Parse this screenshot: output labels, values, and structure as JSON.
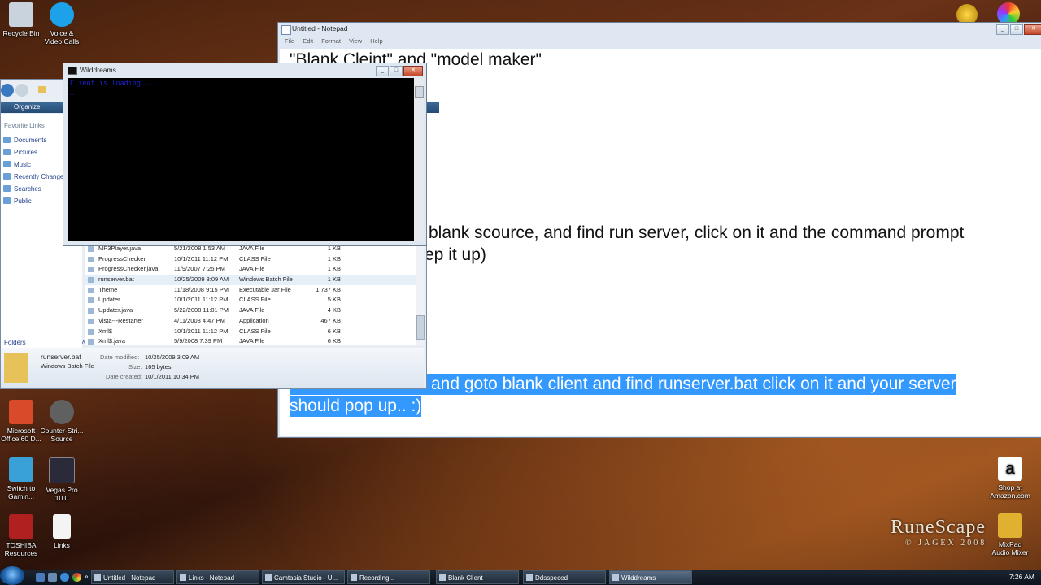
{
  "desktop": {
    "icons": [
      {
        "label": "Recycle Bin",
        "color": "#c9d3de"
      },
      {
        "label": "Voice &\nVideo Calls",
        "color": "#1da1e8"
      },
      {
        "label": "Microsoft\nOffice 60 D...",
        "color": "#d84a2a"
      },
      {
        "label": "Counter-Stri...\nSource",
        "color": "#606060"
      },
      {
        "label": "Switch to\nGamin...",
        "color": "#3aa0d8"
      },
      {
        "label": "Vegas Pro\n10.0",
        "color": "#2a2a3a"
      },
      {
        "label": "TOSHIBA\nResources",
        "color": "#b02020"
      },
      {
        "label": "Links",
        "color": "#f4f4f4"
      },
      {
        "label": "Shop at\nAmazon.com",
        "color": "#ffffff"
      },
      {
        "label": "MixPad\nAudio Mixer",
        "color": "#e0b030"
      }
    ],
    "logo": {
      "name": "RuneScape",
      "sub": "© JAGEX 2008"
    }
  },
  "notepad": {
    "title": "Untitled - Notepad",
    "menu": [
      "File",
      "Edit",
      "Format",
      "View",
      "Help"
    ],
    "lines": [
      "\"Blank Cleint\" and \"model maker\"",
      "blank scource, and find run server, click on it and the command prompt",
      "ep it up)"
    ],
    "selected_lines": [
      "and goto blank client and find runserver.bat click on it and your server",
      "should pop up.. :)"
    ]
  },
  "console": {
    "title": "Wilddreams",
    "output": "Client is loading......"
  },
  "explorer": {
    "organize": "Organize",
    "favorites_header": "Favorite Links",
    "favorites": [
      "Documents",
      "Pictures",
      "Music",
      "Recently Changed",
      "Searches",
      "Public"
    ],
    "folders_label": "Folders",
    "files": [
      {
        "name": "MP3Player.java",
        "date": "5/21/2008 1:53 AM",
        "type": "JAVA File",
        "size": "1 KB"
      },
      {
        "name": "ProgressChecker",
        "date": "10/1/2011 11:12 PM",
        "type": "CLASS File",
        "size": "1 KB"
      },
      {
        "name": "ProgressChecker.java",
        "date": "11/9/2007 7:25 PM",
        "type": "JAVA File",
        "size": "1 KB"
      },
      {
        "name": "runserver.bat",
        "date": "10/25/2009 3:09 AM",
        "type": "Windows Batch File",
        "size": "1 KB"
      },
      {
        "name": "Theme",
        "date": "11/18/2008 9:15 PM",
        "type": "Executable Jar File",
        "size": "1,737 KB"
      },
      {
        "name": "Updater",
        "date": "10/1/2011 11:12 PM",
        "type": "CLASS File",
        "size": "5 KB"
      },
      {
        "name": "Updater.java",
        "date": "5/22/2008 11:01 PM",
        "type": "JAVA File",
        "size": "4 KB"
      },
      {
        "name": "Vista---Restarter",
        "date": "4/11/2008 4:47 PM",
        "type": "Application",
        "size": "467 KB"
      },
      {
        "name": "Xml$",
        "date": "10/1/2011 11:12 PM",
        "type": "CLASS File",
        "size": "6 KB"
      },
      {
        "name": "Xml$.java",
        "date": "5/9/2008 7:39 PM",
        "type": "JAVA File",
        "size": "6 KB"
      }
    ],
    "details": {
      "name": "runserver.bat",
      "type": "Windows Batch File",
      "modified_label": "Date modified:",
      "modified": "10/25/2009 3:09 AM",
      "size_label": "Size:",
      "size": "165 bytes",
      "created_label": "Date created:",
      "created": "10/1/2011 10:34 PM"
    }
  },
  "taskbar": {
    "buttons": [
      "Untitled - Notepad",
      "Links - Notepad",
      "Camtasia Studio - U...",
      "Recording...",
      "Blank Client",
      "Ddsspeced",
      "Wilddreams"
    ],
    "active": "Wilddreams",
    "clock": "7:26 AM"
  }
}
